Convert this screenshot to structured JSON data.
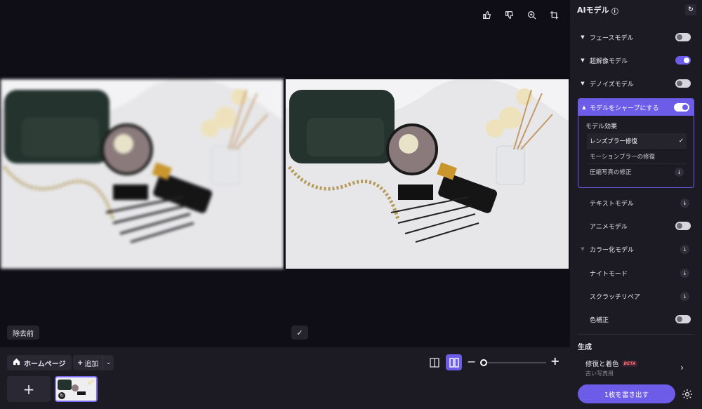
{
  "toolbar": {
    "icons": [
      "thumbs-up-icon",
      "thumbs-down-icon",
      "zoom-in-icon",
      "crop-icon"
    ]
  },
  "canvas": {
    "before_label": "除去前",
    "check_glyph": "✓"
  },
  "bottom": {
    "home_label": "ホームページ",
    "add_label": "追加",
    "add_tile_glyph": "+"
  },
  "panel": {
    "title": "AIモデル",
    "models": [
      {
        "label": "フェースモデル",
        "control": "toggle",
        "on": false
      },
      {
        "label": "超解像モデル",
        "control": "toggle",
        "on": true
      },
      {
        "label": "デノイズモデル",
        "control": "toggle",
        "on": false
      },
      {
        "label": "モデルをシャープにする",
        "control": "toggle",
        "on": true,
        "expanded": true
      },
      {
        "label": "テキストモデル",
        "control": "download"
      },
      {
        "label": "アニメモデル",
        "control": "toggle",
        "on": false
      },
      {
        "label": "カラー化モデル",
        "control": "download"
      },
      {
        "label": "ナイトモード",
        "control": "download"
      },
      {
        "label": "スクラッチリペア",
        "control": "download"
      },
      {
        "label": "色補正",
        "control": "toggle",
        "on": false
      }
    ],
    "sharpen": {
      "sub_title": "モデル効果",
      "options": [
        {
          "label": "レンズブラー修復",
          "selected": true
        },
        {
          "label": "モーションブラーの修復",
          "selected": false
        },
        {
          "label": "圧縮写真の修正",
          "selected": false
        }
      ]
    },
    "generate": {
      "title": "生成",
      "item_title": "修復と着色",
      "item_badge": "BETA",
      "item_subtitle": "古い写真用"
    },
    "export_label": "1枚を書き出す"
  },
  "colors": {
    "accent": "#6c5ce7",
    "background": "#0f0e17",
    "panel": "#1c1b24"
  }
}
